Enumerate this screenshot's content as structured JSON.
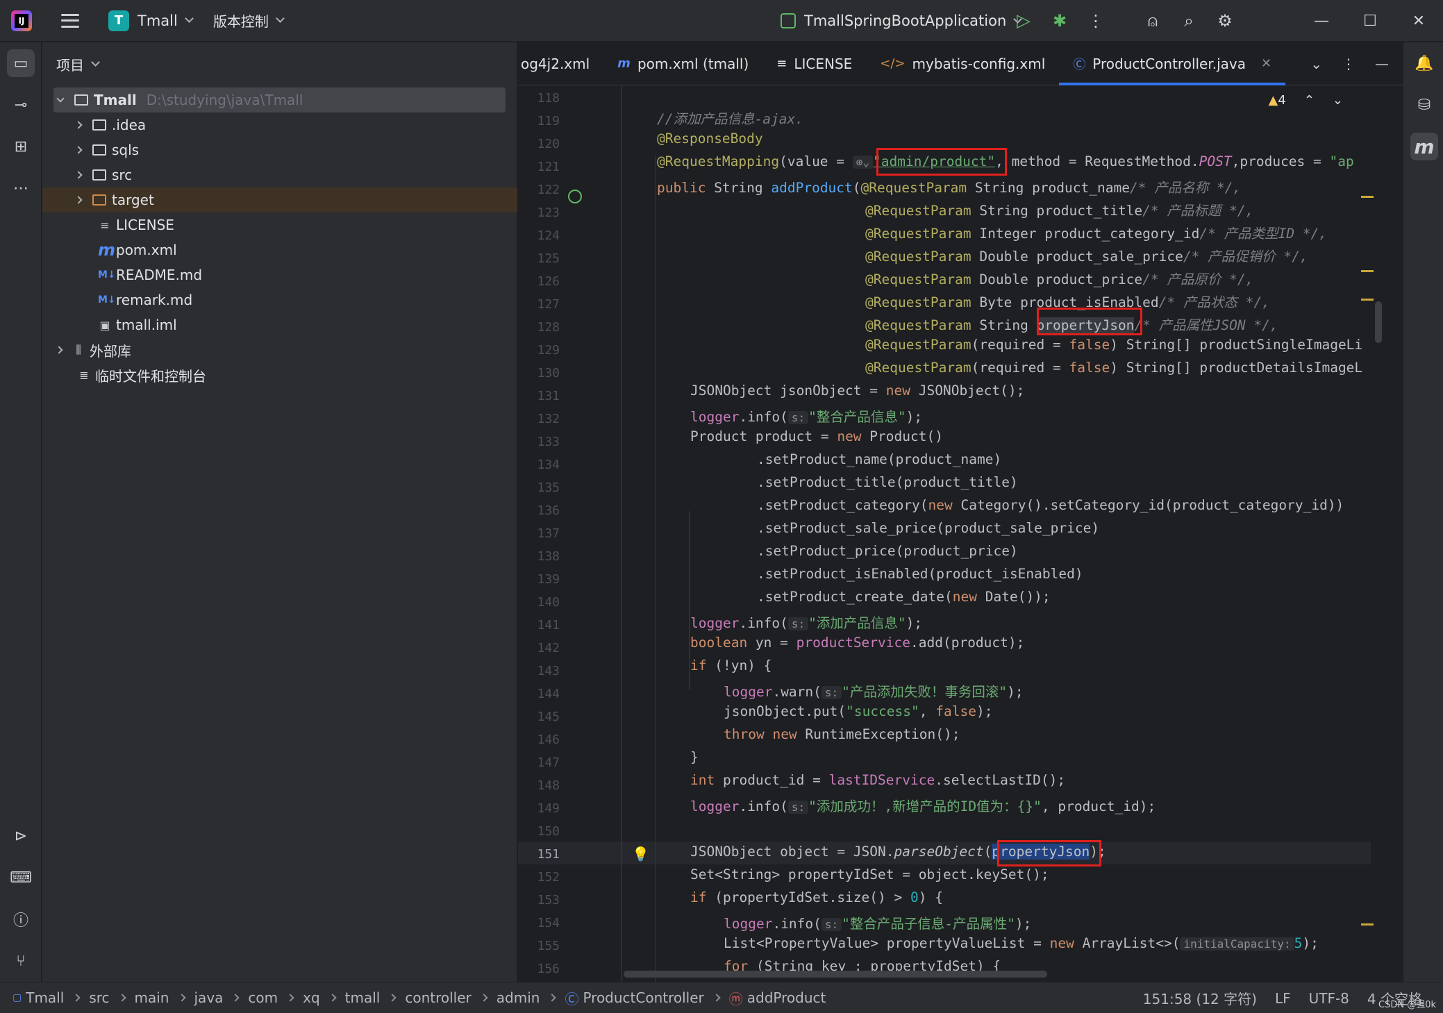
{
  "toolbar": {
    "logo_text": "IJ",
    "project_badge": "T",
    "project_name": "Tmall",
    "vcs_label": "版本控制",
    "run_config": "TmallSpringBootApplication"
  },
  "project_panel": {
    "title": "项目",
    "root": {
      "name": "Tmall",
      "path": "D:\\studying\\java\\Tmall"
    },
    "items": [
      {
        "label": ".idea",
        "kind": "folder"
      },
      {
        "label": "sqls",
        "kind": "folder"
      },
      {
        "label": "src",
        "kind": "folder"
      },
      {
        "label": "target",
        "kind": "folder-excluded"
      },
      {
        "label": "LICENSE",
        "kind": "text"
      },
      {
        "label": "pom.xml",
        "kind": "maven"
      },
      {
        "label": "README.md",
        "kind": "markdown"
      },
      {
        "label": "remark.md",
        "kind": "markdown"
      },
      {
        "label": "tmall.iml",
        "kind": "iml"
      },
      {
        "label": "外部库",
        "kind": "library"
      },
      {
        "label": "临时文件和控制台",
        "kind": "scratch"
      }
    ]
  },
  "tabs": [
    {
      "label": "og4j2.xml",
      "icon": "xml-icon"
    },
    {
      "label": "pom.xml (tmall)",
      "icon": "maven-icon"
    },
    {
      "label": "LICENSE",
      "icon": "text-icon"
    },
    {
      "label": "mybatis-config.xml",
      "icon": "xml-icon"
    },
    {
      "label": "ProductController.java",
      "icon": "class-icon",
      "active": true
    }
  ],
  "editor": {
    "warning_count": "4",
    "current_line": 151,
    "line_numbers": [
      "118",
      "119",
      "120",
      "121",
      "122",
      "123",
      "124",
      "125",
      "126",
      "127",
      "128",
      "129",
      "130",
      "131",
      "132",
      "133",
      "134",
      "135",
      "136",
      "137",
      "138",
      "139",
      "140",
      "141",
      "142",
      "143",
      "144",
      "145",
      "146",
      "147",
      "148",
      "149",
      "150",
      "151",
      "152",
      "153",
      "154",
      "155",
      "156"
    ],
    "code": {
      "l119": "//添加产品信息-ajax.",
      "l120": "@ResponseBody",
      "l121a": "@RequestMapping",
      "l121b": "(value = ",
      "l121c": "\"admin/product\"",
      "l121d": ", method = RequestMethod.",
      "l121e": "POST",
      "l121f": ",produces = ",
      "l121g": "\"ap",
      "l122a": "public ",
      "l122b": "String ",
      "l122c": "addProduct",
      "l122d": "(",
      "l122e": "@RequestParam",
      "l122f": " String product_name",
      "l122g": "/* 产品名称 */,",
      "p123": "@RequestParam",
      "p123b": " String product_title",
      "p123c": "/* 产品标题 */,",
      "p124b": " Integer product_category_id",
      "p124c": "/* 产品类型ID */,",
      "p125b": " Double product_sale_price",
      "p125c": "/* 产品促销价 */,",
      "p126b": " Double product_price",
      "p126c": "/* 产品原价 */,",
      "p127b": " Byte product_isEnabled",
      "p127c": "/* 产品状态 */,",
      "p128b": " String ",
      "p128c": "propertyJson",
      "p128d": "/* 产品属性JSON */,",
      "p129a": "(required = ",
      "p129b": "false",
      "p129c": ") String[] productSingleImageLi",
      "p130c": ") String[] productDetailsImageL",
      "l131a": "JSONObject jsonObject = ",
      "l131b": "new",
      "l131c": " JSONObject();",
      "logger": "logger",
      "info": ".info(",
      "warn": ".warn(",
      "hint_s": "s:",
      "l132s": "\"整合产品信息\"",
      "end": ");",
      "l133a": "Product product = ",
      "l133c": " Product()",
      "l134": ".setProduct_name(product_name)",
      "l135": ".setProduct_title(product_title)",
      "l136a": ".setProduct_category(",
      "l136b": " Category().setCategory_id(product_category_id))",
      "l137": ".setProduct_sale_price(product_sale_price)",
      "l138": ".setProduct_price(product_price)",
      "l139": ".setProduct_isEnabled(product_isEnabled)",
      "l140a": ".setProduct_create_date(",
      "l140b": " Date());",
      "l141s": "\"添加产品信息\"",
      "l142a": "boolean",
      "l142b": " yn = ",
      "l142c": "productService",
      "l142d": ".add(product);",
      "l143a": "if",
      "l143b": " (!yn) {",
      "l144s": "\"产品添加失败！事务回滚\"",
      "l145a": "jsonObject.put(",
      "l145b": "\"success\"",
      "l145c": ", ",
      "l146a": "throw",
      "l146c": " RuntimeException();",
      "l147": "}",
      "l148a": "int",
      "l148b": " product_id = ",
      "l148c": "lastIDService",
      "l148d": ".selectLastID();",
      "l149s": "\"添加成功！,新增产品的ID值为：{}\"",
      "l149b": ", product_id);",
      "l151a": "JSONObject object = JSON.",
      "l151b": "parseObject",
      "l151c": "(",
      "l151d": "propertyJson",
      "l151e": ");",
      "l152": "Set<String> propertyIdSet = object.keySet();",
      "l153b": " (propertyIdSet.size() > ",
      "l153c": "0",
      "l153d": ") {",
      "l154s": "\"整合产品子信息-产品属性\"",
      "l155a": "List<PropertyValue> propertyValueList = ",
      "l155b": " ArrayList<>(",
      "l155h": "initialCapacity:",
      "l155c": "5",
      "l155d": ");",
      "l156a": "for",
      "l156b": " (String key : propertyIdSet) {"
    }
  },
  "statusbar": {
    "crumbs": [
      "Tmall",
      "src",
      "main",
      "java",
      "com",
      "xq",
      "tmall",
      "controller",
      "admin",
      "ProductController",
      "addProduct"
    ],
    "position": "151:58 (12 字符)",
    "line_sep": "LF",
    "encoding": "UTF-8",
    "indent": "4 个空格",
    "watermark": "CSDN @强0k"
  },
  "colors": {
    "accent": "#3574f0",
    "keyword": "#cf8e6d",
    "string": "#6aab73",
    "annotation": "#b3ae60",
    "highlight": "#e0201e"
  }
}
